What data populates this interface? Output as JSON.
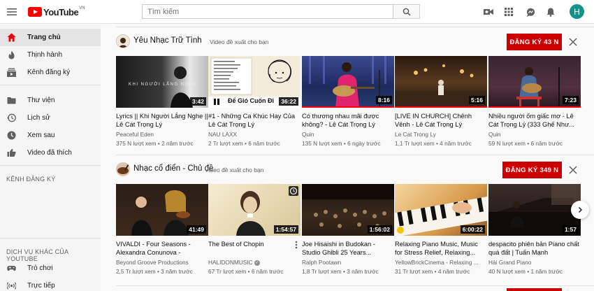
{
  "header": {
    "logo_text": "YouTube",
    "logo_region": "VN",
    "search_placeholder": "Tìm kiếm"
  },
  "avatar_letter": "H",
  "sidebar": {
    "items": [
      {
        "label": "Trang chủ",
        "icon": "home-icon",
        "active": true
      },
      {
        "label": "Thịnh hành",
        "icon": "flame-icon"
      },
      {
        "label": "Kênh đăng ký",
        "icon": "subscriptions-icon"
      },
      {
        "label": "Thư viện",
        "icon": "folder-icon"
      },
      {
        "label": "Lịch sử",
        "icon": "history-icon"
      },
      {
        "label": "Xem sau",
        "icon": "clock-icon"
      },
      {
        "label": "Video đã thích",
        "icon": "thumbs-up-icon"
      }
    ],
    "subscriptions_heading": "KÊNH ĐĂNG KÝ",
    "more_heading": "DỊCH VỤ KHÁC CỦA YOUTUBE",
    "more_items": [
      {
        "label": "Trò chơi",
        "icon": "gamepad-icon"
      },
      {
        "label": "Trực tiếp",
        "icon": "live-icon"
      }
    ]
  },
  "shelves": [
    {
      "channel": "Yêu Nhạc Trữ Tình",
      "subtitle": "Video đề xuất cho bạn",
      "subscribe": "ĐĂNG KÝ  43 N",
      "videos": [
        {
          "title": "Lyrics || Khi Người Lắng Nghe || Lê Cát Trọng Lý",
          "channel": "Peaceful Eden",
          "meta": "375 N lượt xem • 2 năm trước",
          "duration": "3:42",
          "thumb_text": "KHI NGƯỜI LẮNG NGHE"
        },
        {
          "title": "#1 - Những Ca Khúc Hay Của Lê Cát Trọng Lý",
          "channel": "NAU LAXX",
          "meta": "2 Tr lượt xem • 6 năm trước",
          "duration": "36:22",
          "thumb_text": "Để Gió Cuốn Đi"
        },
        {
          "title": "Có thương nhau mãi được không? - Lê Cát Trọng Lý",
          "channel": "Quin",
          "meta": "135 N lượt xem • 6 ngày trước",
          "duration": "8:16"
        },
        {
          "title": "[LIVE IN CHURCH] Chênh Vênh - Lê Cát Trọng Lý",
          "channel": "Le Cat Trong Ly",
          "meta": "1,1 Tr lượt xem • 4 năm trước",
          "duration": "5:16"
        },
        {
          "title": "Nhiều người ốm giấc mơ - Lê Cát Trọng Lý (333 Ghế Như...",
          "channel": "Quin",
          "meta": "59 N lượt xem • 6 năm trước",
          "duration": "7:23"
        }
      ]
    },
    {
      "channel": "Nhạc cổ điển - Chủ đề",
      "subtitle": "Video đề xuất cho bạn",
      "subscribe": "ĐĂNG KÝ  349 N",
      "videos": [
        {
          "title": "VIVALDI - Four Seasons - Alexandra Conunova -",
          "channel": "Beyond Groove Productions",
          "meta": "2,5 Tr lượt xem • 3 năm trước",
          "duration": "41:49"
        },
        {
          "title": "The Best of Chopin",
          "channel": "HALIDONMUSIC",
          "meta": "67 Tr lượt xem • 6 năm trước",
          "duration": "1:54:57"
        },
        {
          "title": "Joe Hisaishi in Budokan - Studio Ghibli 25 Years...",
          "channel": "Ralph Pootawn",
          "meta": "1,8 Tr lượt xem • 3 năm trước",
          "duration": "1:56:02"
        },
        {
          "title": "Relaxing Piano Music, Music for Stress Relief, Relaxing...",
          "channel": "YellowBrickCinema - Relaxing ...",
          "meta": "31 Tr lượt xem • 4 năm trước",
          "duration": "6:00:22"
        },
        {
          "title": "despacito phiên bản Piano chất quá đất | Tuấn Mạnh",
          "channel": "Hải Grand Piano",
          "meta": "40 N lượt xem • 1 năm trước",
          "duration": "1:57"
        }
      ]
    }
  ]
}
